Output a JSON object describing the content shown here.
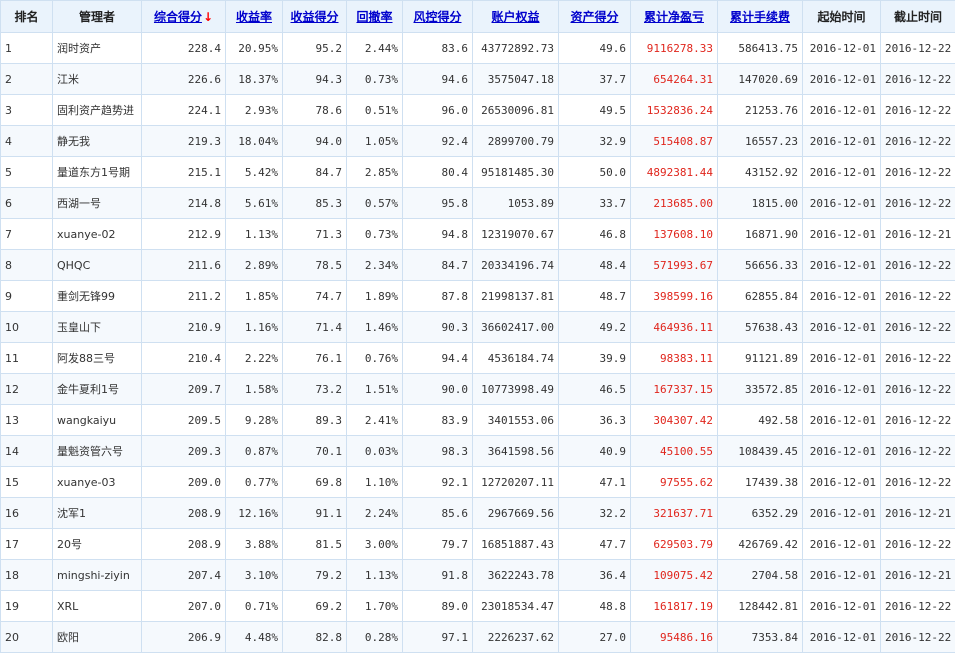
{
  "columns": [
    {
      "key": "rank",
      "label": "排名",
      "sortable": false
    },
    {
      "key": "manager",
      "label": "管理者",
      "sortable": false
    },
    {
      "key": "composite_score",
      "label": "综合得分",
      "sortable": true,
      "sort_indicator": "↓"
    },
    {
      "key": "return_rate",
      "label": "收益率",
      "sortable": true
    },
    {
      "key": "return_score",
      "label": "收益得分",
      "sortable": true
    },
    {
      "key": "drawdown_rate",
      "label": "回撤率",
      "sortable": true
    },
    {
      "key": "risk_score",
      "label": "风控得分",
      "sortable": true
    },
    {
      "key": "account_equity",
      "label": "账户权益",
      "sortable": true
    },
    {
      "key": "asset_score",
      "label": "资产得分",
      "sortable": true
    },
    {
      "key": "cum_net_pnl",
      "label": "累计净盈亏",
      "sortable": true
    },
    {
      "key": "cum_fees",
      "label": "累计手续费",
      "sortable": true
    },
    {
      "key": "start_time",
      "label": "起始时间",
      "sortable": false
    },
    {
      "key": "end_time",
      "label": "截止时间",
      "sortable": false
    }
  ],
  "rows": [
    [
      "1",
      "润时资产",
      "228.4",
      "20.95%",
      "95.2",
      "2.44%",
      "83.6",
      "43772892.73",
      "49.6",
      "9116278.33",
      "586413.75",
      "2016-12-01",
      "2016-12-22"
    ],
    [
      "2",
      "江米",
      "226.6",
      "18.37%",
      "94.3",
      "0.73%",
      "94.6",
      "3575047.18",
      "37.7",
      "654264.31",
      "147020.69",
      "2016-12-01",
      "2016-12-22"
    ],
    [
      "3",
      "固利资产趋势进",
      "224.1",
      "2.93%",
      "78.6",
      "0.51%",
      "96.0",
      "26530096.81",
      "49.5",
      "1532836.24",
      "21253.76",
      "2016-12-01",
      "2016-12-22"
    ],
    [
      "4",
      "静无我",
      "219.3",
      "18.04%",
      "94.0",
      "1.05%",
      "92.4",
      "2899700.79",
      "32.9",
      "515408.87",
      "16557.23",
      "2016-12-01",
      "2016-12-22"
    ],
    [
      "5",
      "量道东方1号期",
      "215.1",
      "5.42%",
      "84.7",
      "2.85%",
      "80.4",
      "95181485.30",
      "50.0",
      "4892381.44",
      "43152.92",
      "2016-12-01",
      "2016-12-22"
    ],
    [
      "6",
      "西湖一号",
      "214.8",
      "5.61%",
      "85.3",
      "0.57%",
      "95.8",
      "1053.89",
      "33.7",
      "213685.00",
      "1815.00",
      "2016-12-01",
      "2016-12-22"
    ],
    [
      "7",
      "xuanye-02",
      "212.9",
      "1.13%",
      "71.3",
      "0.73%",
      "94.8",
      "12319070.67",
      "46.8",
      "137608.10",
      "16871.90",
      "2016-12-01",
      "2016-12-21"
    ],
    [
      "8",
      "QHQC",
      "211.6",
      "2.89%",
      "78.5",
      "2.34%",
      "84.7",
      "20334196.74",
      "48.4",
      "571993.67",
      "56656.33",
      "2016-12-01",
      "2016-12-22"
    ],
    [
      "9",
      "重剑无锋99",
      "211.2",
      "1.85%",
      "74.7",
      "1.89%",
      "87.8",
      "21998137.81",
      "48.7",
      "398599.16",
      "62855.84",
      "2016-12-01",
      "2016-12-22"
    ],
    [
      "10",
      "玉皇山下",
      "210.9",
      "1.16%",
      "71.4",
      "1.46%",
      "90.3",
      "36602417.00",
      "49.2",
      "464936.11",
      "57638.43",
      "2016-12-01",
      "2016-12-22"
    ],
    [
      "11",
      "阿发88三号",
      "210.4",
      "2.22%",
      "76.1",
      "0.76%",
      "94.4",
      "4536184.74",
      "39.9",
      "98383.11",
      "91121.89",
      "2016-12-01",
      "2016-12-22"
    ],
    [
      "12",
      "金牛夏利1号",
      "209.7",
      "1.58%",
      "73.2",
      "1.51%",
      "90.0",
      "10773998.49",
      "46.5",
      "167337.15",
      "33572.85",
      "2016-12-01",
      "2016-12-22"
    ],
    [
      "13",
      "wangkaiyu",
      "209.5",
      "9.28%",
      "89.3",
      "2.41%",
      "83.9",
      "3401553.06",
      "36.3",
      "304307.42",
      "492.58",
      "2016-12-01",
      "2016-12-22"
    ],
    [
      "14",
      "量魁资管六号",
      "209.3",
      "0.87%",
      "70.1",
      "0.03%",
      "98.3",
      "3641598.56",
      "40.9",
      "45100.55",
      "108439.45",
      "2016-12-01",
      "2016-12-22"
    ],
    [
      "15",
      "xuanye-03",
      "209.0",
      "0.77%",
      "69.8",
      "1.10%",
      "92.1",
      "12720207.11",
      "47.1",
      "97555.62",
      "17439.38",
      "2016-12-01",
      "2016-12-22"
    ],
    [
      "16",
      "沈军1",
      "208.9",
      "12.16%",
      "91.1",
      "2.24%",
      "85.6",
      "2967669.56",
      "32.2",
      "321637.71",
      "6352.29",
      "2016-12-01",
      "2016-12-21"
    ],
    [
      "17",
      "20号",
      "208.9",
      "3.88%",
      "81.5",
      "3.00%",
      "79.7",
      "16851887.43",
      "47.7",
      "629503.79",
      "426769.42",
      "2016-12-01",
      "2016-12-22"
    ],
    [
      "18",
      "mingshi-ziyin",
      "207.4",
      "3.10%",
      "79.2",
      "1.13%",
      "91.8",
      "3622243.78",
      "36.4",
      "109075.42",
      "2704.58",
      "2016-12-01",
      "2016-12-21"
    ],
    [
      "19",
      "XRL",
      "207.0",
      "0.71%",
      "69.2",
      "1.70%",
      "89.0",
      "23018534.47",
      "48.8",
      "161817.19",
      "128442.81",
      "2016-12-01",
      "2016-12-22"
    ],
    [
      "20",
      "欧阳",
      "206.9",
      "4.48%",
      "82.8",
      "0.28%",
      "97.1",
      "2226237.62",
      "27.0",
      "95486.16",
      "7353.84",
      "2016-12-01",
      "2016-12-22"
    ]
  ],
  "colors": {
    "header_bg": "#eaf3fc",
    "border": "#cfe0f1",
    "link": "#0000cc",
    "pnl_red": "#e0251c",
    "sort_arrow": "#ff0000"
  }
}
